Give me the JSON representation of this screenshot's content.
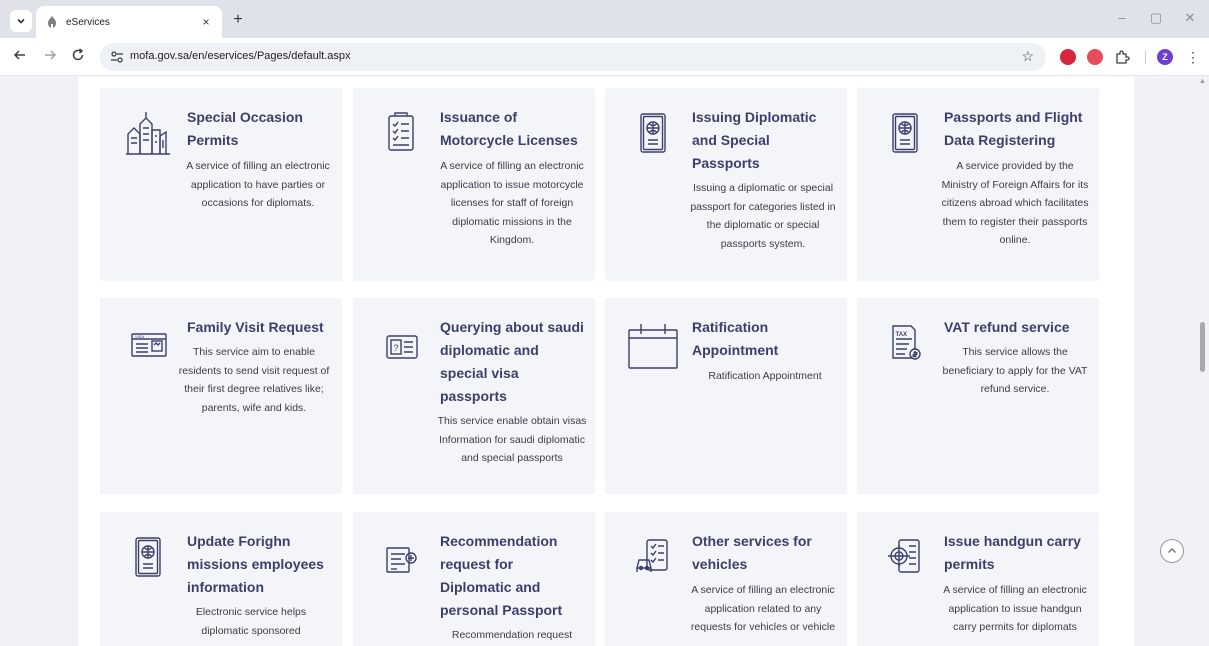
{
  "browser": {
    "tab_title": "eServices",
    "tab_close": "×",
    "new_tab": "+",
    "url": "mofa.gov.sa/en/eservices/Pages/default.aspx",
    "profile_initial": "Z",
    "controls": {
      "minimize": "–",
      "restore": "▢",
      "close": "✕"
    }
  },
  "services": [
    {
      "title": "Special Occasion Permits",
      "description": "A service of filling an electronic application to have parties or occasions for diplomats.",
      "icon": "city-skyline-icon"
    },
    {
      "title": "Issuance of Motorcycle Licenses",
      "description": "A service of filling an electronic application to issue motorcycle licenses for staff of foreign diplomatic missions in the Kingdom.",
      "icon": "checklist-document-icon"
    },
    {
      "title": "Issuing Diplomatic and Special Passports",
      "description": "Issuing a diplomatic or special passport for categories listed in the diplomatic or special passports system.",
      "icon": "passport-icon"
    },
    {
      "title": "Passports and Flight Data Registering",
      "description": "A service provided by the Ministry of Foreign Affairs for its citizens abroad which facilitates them to register their passports online.",
      "icon": "passport-icon"
    },
    {
      "title": "Family Visit Request",
      "description": "This service aim to enable residents to send visit request of their first degree relatives like; parents, wife and kids.",
      "icon": "visa-card-icon"
    },
    {
      "title": "Querying about saudi diplomatic and special visa passports",
      "description": "This service enable obtain visas Information for saudi diplomatic and special passports",
      "icon": "id-query-icon"
    },
    {
      "title": "Ratification Appointment",
      "description": "Ratification Appointment",
      "icon": "calendar-icon"
    },
    {
      "title": "VAT refund service",
      "description": "This service allows the beneficiary to apply for the VAT refund service.",
      "icon": "tax-document-icon"
    },
    {
      "title": "Update Forighn missions employees information",
      "description": "Electronic service helps diplomatic sponsored",
      "icon": "passport-icon"
    },
    {
      "title": "Recommendation request for Diplomatic and personal Passport",
      "description": "Recommendation request",
      "icon": "recommendation-document-icon"
    },
    {
      "title": "Other services for vehicles",
      "description": "A service of filling an electronic application related to any requests for vehicles or vehicle",
      "icon": "vehicle-checklist-icon"
    },
    {
      "title": "Issue handgun carry permits",
      "description": "A service of filling an electronic application to issue handgun carry permits for diplomats",
      "icon": "target-document-icon"
    }
  ]
}
